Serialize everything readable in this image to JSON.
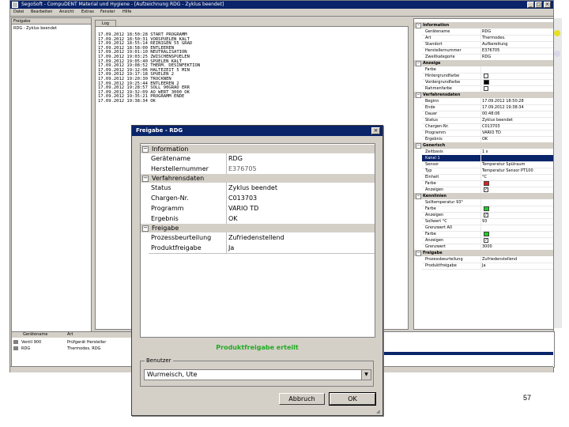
{
  "app": {
    "title": "SegoSoft - CompuDENT Material und Hygiene - [Aufzeichnung RDG - Zyklus beendet]",
    "menu": [
      "Datei",
      "Bearbeiten",
      "Ansicht",
      "Extras",
      "Fenster",
      "Hilfe"
    ]
  },
  "left_panel": {
    "header": "Freigabe",
    "item": "RDG - Zyklus beendet"
  },
  "log": {
    "tab": "Log",
    "lines": [
      "17.09.2012 18:50:28 START PROGRAMM",
      "17.09.2012 18:50:31 VORSPUELEN KALT",
      "17.09.2012 18:55:14 REINIGEN 55 GRAD",
      "17.09.2012 18:58:00 ENTLEEREN",
      "17.09.2012 19:01:10 NEUTRALISATION",
      "17.09.2012 19:03:25 ZWISCHENSPUELEN",
      "17.09.2012 19:05:40 SPUELEN KALT",
      "17.09.2012 19:08:52 THERM. DESINFEKTION",
      "17.09.2012 19:12:06 HALTEZEIT 5 MIN",
      "17.09.2012 19:17:18 SPUELEN 2",
      "17.09.2012 19:20:30 TROCKNEN",
      "17.09.2012 19:25:44 ENTLEEREN 2",
      "17.09.2012 19:28:57 SOLL 90GRAD ERR",
      "17.09.2012 19:32:09 AO WERT 3000 OK",
      "17.09.2012 19:35:21 PROGRAMM ENDE",
      "17.09.2012 19:38:34 OK"
    ]
  },
  "props": {
    "sections": {
      "info": "Information",
      "display": "Anzeige",
      "process": "Verfahrensdaten",
      "generic": "Generisch",
      "marks": "Kennlinien",
      "release": "Freigabe"
    },
    "info_rows": [
      {
        "k": "Gerätename",
        "v": "RDG"
      },
      {
        "k": "Art",
        "v": "Thermodes."
      },
      {
        "k": "Standort",
        "v": "Aufbereitung"
      },
      {
        "k": "Herstellernummer",
        "v": "E376705"
      },
      {
        "k": "Zweitkategorie",
        "v": "RDG"
      }
    ],
    "display_rows": [
      {
        "k": "Farbe",
        "v": ""
      },
      {
        "k": "Hintergrundfarbe",
        "v": ""
      },
      {
        "k": "Vordergrundfarbe",
        "v": ""
      },
      {
        "k": "Rahmenfarbe",
        "v": ""
      }
    ],
    "process_rows": [
      {
        "k": "Beginn",
        "v": "17.09.2012 18:50:28"
      },
      {
        "k": "Ende",
        "v": "17.09.2012 19:38:34"
      },
      {
        "k": "Dauer",
        "v": "00:48:06"
      },
      {
        "k": "Status",
        "v": "Zyklus beendet"
      },
      {
        "k": "Chargen-Nr.",
        "v": "C013703"
      },
      {
        "k": "Programm",
        "v": "VARIO TD"
      },
      {
        "k": "Ergebnis",
        "v": "OK"
      }
    ],
    "generic_rows": [
      {
        "k": "Zeitbasis",
        "v": "1 s"
      },
      {
        "k": "Kanal 1",
        "v": "",
        "sel": true
      },
      {
        "k": "Sensor",
        "v": "Temperatur Spülraum"
      },
      {
        "k": "Typ",
        "v": "Temperatur Sensor PT100"
      },
      {
        "k": "Einheit",
        "v": "°C"
      },
      {
        "k": "Farbe",
        "v": ""
      },
      {
        "k": "Anzeigen",
        "v": ""
      }
    ],
    "mark_rows": [
      {
        "k": "Solltemperatur 93°",
        "v": ""
      },
      {
        "k": "Farbe",
        "v": ""
      },
      {
        "k": "Anzeigen",
        "v": ""
      },
      {
        "k": "Sollwert °C",
        "v": "93"
      },
      {
        "k": "Grenzwert A0",
        "v": ""
      },
      {
        "k": "Farbe",
        "v": ""
      },
      {
        "k": "Anzeigen",
        "v": ""
      },
      {
        "k": "Grenzwert",
        "v": "3000"
      }
    ],
    "release_rows": [
      {
        "k": "Prozessbeurteilung",
        "v": "Zufriedenstellend"
      },
      {
        "k": "Produktfreigabe",
        "v": "Ja"
      }
    ]
  },
  "bottom": {
    "header_name": "Gerätename",
    "header_type": "Art",
    "rows": [
      {
        "name": "Ventil 900",
        "type": "Prüfgerät Hersteller"
      },
      {
        "name": "RDG",
        "type": "Thermodes. RDG"
      }
    ]
  },
  "dialog": {
    "title": "Freigabe - RDG",
    "sections": {
      "info": "Information",
      "process": "Verfahrensdaten",
      "release": "Freigabe"
    },
    "info_rows": [
      {
        "k": "Gerätename",
        "v": "RDG"
      },
      {
        "k": "Herstellernummer",
        "v": "E376705"
      }
    ],
    "process_rows": [
      {
        "k": "Status",
        "v": "Zyklus beendet"
      },
      {
        "k": "Chargen-Nr.",
        "v": "C013703"
      },
      {
        "k": "Programm",
        "v": "VARIO TD"
      },
      {
        "k": "Ergebnis",
        "v": "OK"
      }
    ],
    "release_rows": [
      {
        "k": "Prozessbeurteilung",
        "v": "Zufriedenstellend"
      },
      {
        "k": "Produktfreigabe",
        "v": "Ja"
      }
    ],
    "release_message": "Produktfreigabe erteilt",
    "user_group_label": "Benutzer",
    "user_value": "Wurmeisch, Ute",
    "cancel_label": "Abbruch",
    "ok_label": "OK"
  },
  "page_number": "57",
  "colors": {
    "titlebar": "#0a246a",
    "release_message": "#22aa22",
    "swatch_red": "#dd2222",
    "swatch_green": "#22cc22",
    "swatch_black": "#000000"
  }
}
